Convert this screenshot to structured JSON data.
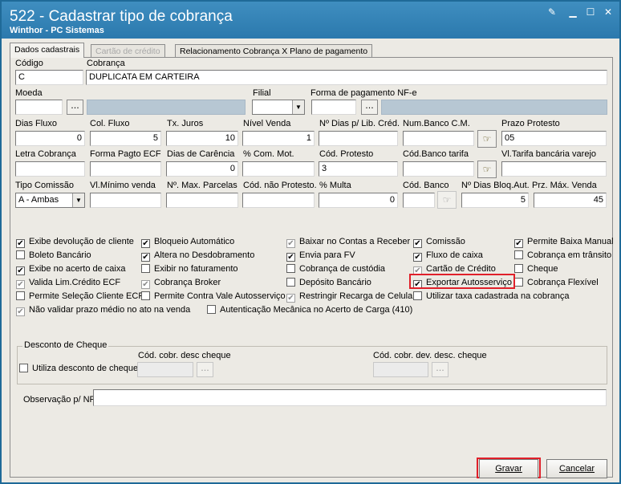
{
  "window": {
    "title": "522 - Cadastrar tipo de cobrança",
    "subtitle": "Winthor - PC Sistemas"
  },
  "tabs": [
    {
      "label": "Dados cadastrais"
    },
    {
      "label": "Cartão de crédito"
    },
    {
      "label": "Relacionamento Cobrança X Plano de pagamento"
    }
  ],
  "fields": {
    "codigo": {
      "label": "Código",
      "value": "C"
    },
    "cobranca": {
      "label": "Cobrança",
      "value": "DUPLICATA EM CARTEIRA"
    },
    "moeda": {
      "label": "Moeda",
      "value": ""
    },
    "filial": {
      "label": "Filial",
      "value": ""
    },
    "forma_pagamento_nfe": {
      "label": "Forma de pagamento NF-e",
      "value": ""
    },
    "dias_fluxo": {
      "label": "Dias Fluxo",
      "value": "0"
    },
    "col_fluxo": {
      "label": "Col. Fluxo",
      "value": "5"
    },
    "tx_juros": {
      "label": "Tx. Juros",
      "value": "10"
    },
    "nivel_venda": {
      "label": "Nível Venda",
      "value": "1"
    },
    "n_dias_lib_cred": {
      "label": "Nº Dias p/ Lib. Créd.",
      "value": ""
    },
    "num_banco_cm": {
      "label": "Num.Banco C.M.",
      "value": ""
    },
    "prazo_protesto": {
      "label": "Prazo Protesto",
      "value": "05"
    },
    "letra_cobranca": {
      "label": "Letra Cobrança",
      "value": ""
    },
    "forma_pagto_ecf": {
      "label": "Forma Pagto ECF",
      "value": ""
    },
    "dias_carencia": {
      "label": "Dias de Carência",
      "value": "0"
    },
    "com_mot": {
      "label": "% Com. Mot.",
      "value": ""
    },
    "cod_protesto": {
      "label": "Cód. Protesto",
      "value": "3"
    },
    "cod_banco_tarifa": {
      "label": "Cód.Banco tarifa",
      "value": ""
    },
    "vl_tarifa_bancaria": {
      "label": "Vl.Tarifa bancária varejo",
      "value": ""
    },
    "tipo_comissao": {
      "label": "Tipo Comissão",
      "value": "A - Ambas"
    },
    "vl_minimo_venda": {
      "label": "Vl.Mínimo venda",
      "value": ""
    },
    "n_max_parcelas": {
      "label": "Nº. Max. Parcelas",
      "value": ""
    },
    "cod_nao_protesto": {
      "label": "Cód. não Protesto.",
      "value": ""
    },
    "multa": {
      "label": "% Multa",
      "value": "0"
    },
    "cod_banco": {
      "label": "Cód. Banco",
      "value": ""
    },
    "n_dias_bloq_aut": {
      "label": "Nº Dias Bloq.Aut.",
      "value": "5"
    },
    "prz_max_venda": {
      "label": "Prz. Máx. Venda",
      "value": "45"
    }
  },
  "ellipsis": "...",
  "checkboxes": [
    {
      "id": "c1",
      "label": "Exibe devolução de cliente",
      "checked": true,
      "disabled": false
    },
    {
      "id": "c2",
      "label": "Boleto Bancário",
      "checked": false,
      "disabled": false
    },
    {
      "id": "c3",
      "label": "Exibe no acerto de caixa",
      "checked": true,
      "disabled": false
    },
    {
      "id": "c4",
      "label": "Valida Lim.Crédito ECF",
      "checked": true,
      "disabled": true
    },
    {
      "id": "c5",
      "label": "Permite Seleção Cliente ECF",
      "checked": false,
      "disabled": false
    },
    {
      "id": "c6",
      "label": "Não validar prazo médio no ato na venda",
      "checked": true,
      "disabled": true
    },
    {
      "id": "c7",
      "label": "Bloqueio Automático",
      "checked": true,
      "disabled": false
    },
    {
      "id": "c8",
      "label": "Altera no Desdobramento",
      "checked": true,
      "disabled": false
    },
    {
      "id": "c9",
      "label": "Exibir no faturamento",
      "checked": false,
      "disabled": false
    },
    {
      "id": "c10",
      "label": "Cobrança Broker",
      "checked": true,
      "disabled": true
    },
    {
      "id": "c11",
      "label": "Permite Contra Vale Autosserviço",
      "checked": false,
      "disabled": false
    },
    {
      "id": "c12",
      "label": "Autenticação Mecânica no Acerto de Carga (410)",
      "checked": false,
      "disabled": false
    },
    {
      "id": "c13",
      "label": "Baixar no Contas a Receber",
      "checked": true,
      "disabled": true
    },
    {
      "id": "c14",
      "label": "Envia para FV",
      "checked": true,
      "disabled": false
    },
    {
      "id": "c15",
      "label": "Cobrança de custódia",
      "checked": false,
      "disabled": false
    },
    {
      "id": "c16",
      "label": "Depósito Bancário",
      "checked": false,
      "disabled": false
    },
    {
      "id": "c17",
      "label": "Restringir Recarga de Celular",
      "checked": true,
      "disabled": true
    },
    {
      "id": "c18",
      "label": "Comissão",
      "checked": true,
      "disabled": false
    },
    {
      "id": "c19",
      "label": "Fluxo de caixa",
      "checked": true,
      "disabled": false
    },
    {
      "id": "c20",
      "label": "Cartão de Crédito",
      "checked": true,
      "disabled": true
    },
    {
      "id": "c21",
      "label": "Exportar Autosserviço",
      "checked": true,
      "disabled": false
    },
    {
      "id": "c22",
      "label": "Utilizar taxa cadastrada na cobrança",
      "checked": false,
      "disabled": false
    },
    {
      "id": "c23",
      "label": "Permite Baixa Manual",
      "checked": true,
      "disabled": false
    },
    {
      "id": "c24",
      "label": "Cobrança em trânsito",
      "checked": false,
      "disabled": false
    },
    {
      "id": "c25",
      "label": "Cheque",
      "checked": false,
      "disabled": false
    },
    {
      "id": "c26",
      "label": "Cobrança Flexível",
      "checked": false,
      "disabled": false
    }
  ],
  "desconto_cheque": {
    "title": "Desconto de Cheque",
    "utiliza_label": "Utiliza desconto de cheque",
    "utiliza_checked": false,
    "cod_desc_label": "Cód. cobr. desc cheque",
    "cod_dev_label": "Cód. cobr. dev. desc. cheque"
  },
  "observacao": {
    "label": "Observação p/ NF:",
    "value": ""
  },
  "buttons": {
    "gravar": "Gravar",
    "cancelar": "Cancelar"
  },
  "colors": {
    "titlebar": "#2b79ad",
    "highlight": "#e0202a"
  }
}
